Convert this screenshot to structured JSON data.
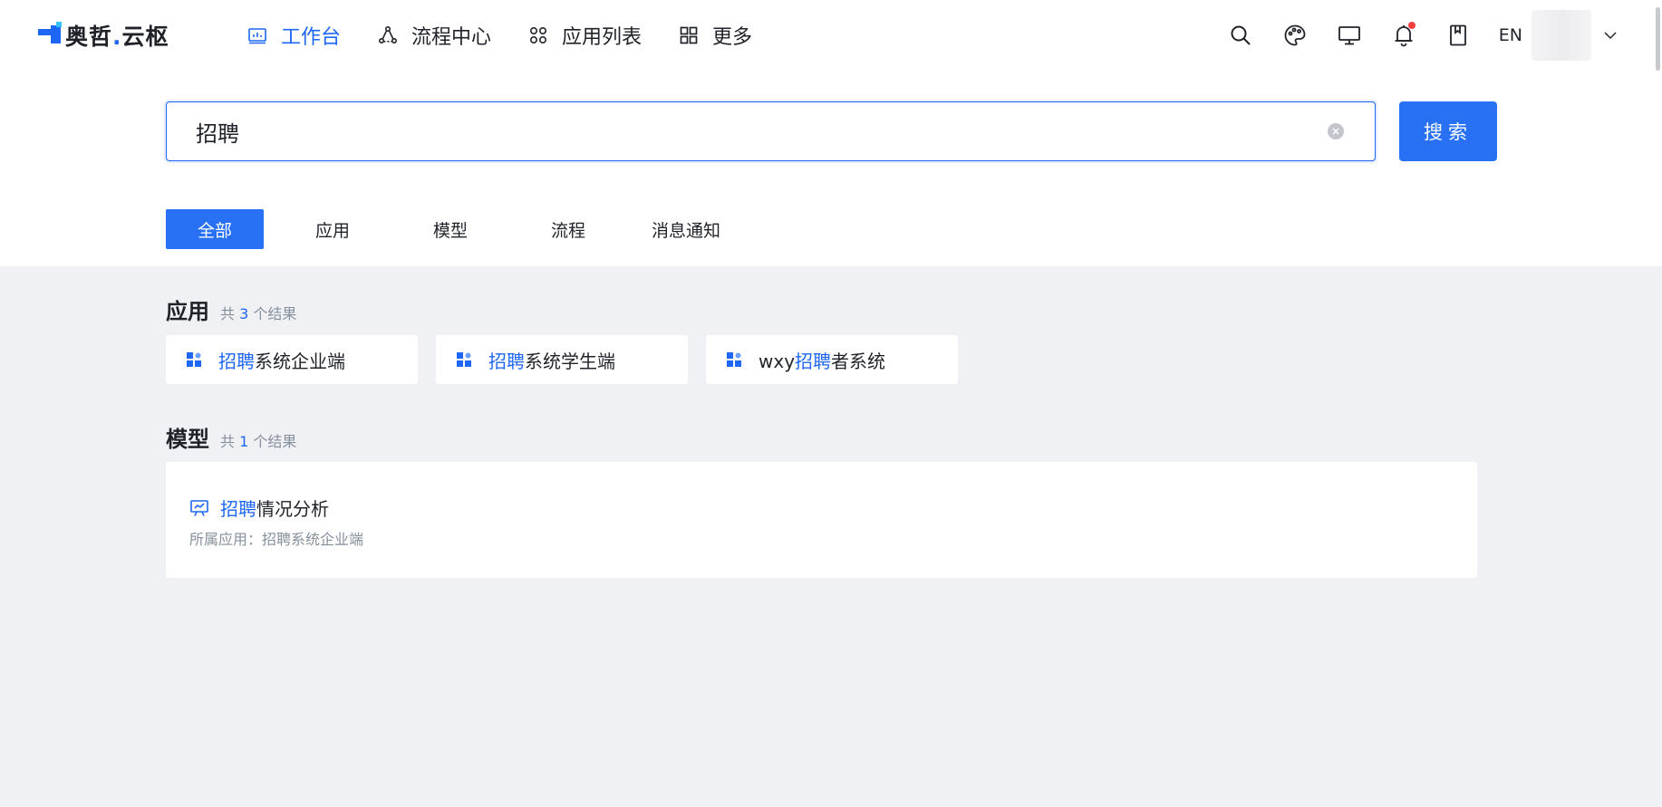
{
  "header": {
    "logo": {
      "text_before_dot": "奥哲",
      "dot": ".",
      "text_after_dot": "云枢"
    },
    "nav": [
      {
        "label": "工作台",
        "icon": "dashboard-icon",
        "active": true
      },
      {
        "label": "流程中心",
        "icon": "workflow-icon",
        "active": false
      },
      {
        "label": "应用列表",
        "icon": "app-grid-icon",
        "active": false
      },
      {
        "label": "更多",
        "icon": "more-grid-icon",
        "active": false
      }
    ],
    "tools": [
      "search-icon",
      "palette-icon",
      "monitor-icon",
      "bell-icon",
      "book-icon"
    ],
    "language": "EN"
  },
  "search": {
    "value": "招聘",
    "button_label": "搜索"
  },
  "tabs": [
    {
      "label": "全部",
      "active": true
    },
    {
      "label": "应用",
      "active": false
    },
    {
      "label": "模型",
      "active": false
    },
    {
      "label": "流程",
      "active": false
    },
    {
      "label": "消息通知",
      "active": false
    }
  ],
  "results": {
    "apps": {
      "title": "应用",
      "count_prefix": "共",
      "count": "3",
      "count_suffix": "个结果",
      "items": [
        {
          "prefix": "",
          "highlight": "招聘",
          "suffix": "系统企业端"
        },
        {
          "prefix": "",
          "highlight": "招聘",
          "suffix": "系统学生端"
        },
        {
          "prefix": "wxy",
          "highlight": "招聘",
          "suffix": "者系统"
        }
      ]
    },
    "models": {
      "title": "模型",
      "count_prefix": "共",
      "count": "1",
      "count_suffix": "个结果",
      "items": [
        {
          "highlight": "招聘",
          "suffix": "情况分析",
          "subtitle": "所属应用：招聘系统企业端"
        }
      ]
    }
  },
  "colors": {
    "accent": "#2871f5",
    "highlight": "#1e66f5",
    "page_bg": "#f0f1f5",
    "muted": "#86909c",
    "notify": "#f53f3f"
  }
}
